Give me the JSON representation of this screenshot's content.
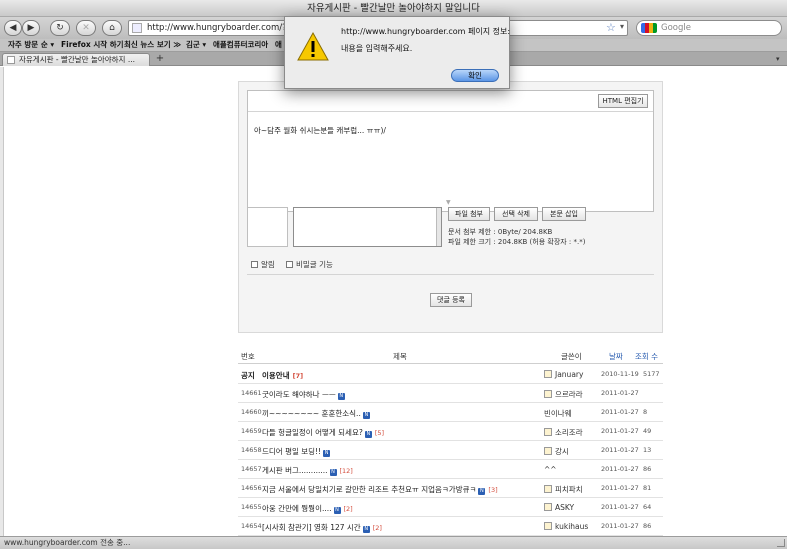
{
  "window": {
    "title": "자유게시판 - 빨간날만 놀아야하지 말입니다"
  },
  "toolbar": {
    "back_label": "◀",
    "forward_label": "▶",
    "reload_label": "↻",
    "stop_label": "✕",
    "home_label": "⌂",
    "url": "http://www.hungryboarder.com/?mid=",
    "search_placeholder": "Google"
  },
  "bookmarks": [
    "자주 방문 순 ▾",
    "Firefox 시작 하기",
    "최신 뉴스 보기 ≫",
    "김군 ▾",
    "애플컴퓨터코리아",
    "애"
  ],
  "tab": {
    "label": "자유게시판 - 빨간날만 놀아야하지 ...",
    "new_tab_label": "+"
  },
  "dialog": {
    "title": "http://www.hungryboarder.com 페이지 정보:",
    "message": "내용을 입력해주세요.",
    "ok_label": "확인"
  },
  "editor": {
    "html_button": "HTML 편집기",
    "content": "아~담주 월화 쉬시는분들 캐부럽... ㅠㅠ)/"
  },
  "attachments": {
    "attach_button": "파일 첨부",
    "delete_button": "선택 삭제",
    "insert_button": "본문 삽입",
    "limit_text": "문서 첨부 제한 : 0Byte/ 204.8KB",
    "size_text": "파일 제한 크기 : 204.8KB (허용 확장자 : *.*)"
  },
  "options": {
    "notify_label": "알림",
    "secret_label": "비밀글 기능"
  },
  "submit_button": "댓글 등록",
  "list": {
    "headers": {
      "number": "번호",
      "title": "제목",
      "author": "글쓴이",
      "date": "날짜",
      "views": "조회 수"
    },
    "rows": [
      {
        "num": "공지",
        "title": "이용안내",
        "comments": "[7]",
        "new": false,
        "author": "January",
        "date": "2010-11-19",
        "views": "5177",
        "notice": true
      },
      {
        "num": "14661",
        "title": "굿이라도 해야하나 ㅡㅡ",
        "comments": "",
        "new": true,
        "author": "으르라라",
        "date": "2011-01-27",
        "views": "",
        "notice": false
      },
      {
        "num": "14660",
        "title": "끼~~~~~~~~ 훈훈한소식..",
        "comments": "",
        "new": true,
        "author": "빈이나웨",
        "date": "2011-01-27",
        "views": "8",
        "notice": false
      },
      {
        "num": "14659",
        "title": "다들 헝글일정이 어떻게 되세요?",
        "comments": "[5]",
        "new": true,
        "author": "소리조라",
        "date": "2011-01-27",
        "views": "49",
        "notice": false
      },
      {
        "num": "14658",
        "title": "드디어 평일 보딩!!",
        "comments": "",
        "new": true,
        "author": "강시",
        "date": "2011-01-27",
        "views": "13",
        "notice": false
      },
      {
        "num": "14657",
        "title": "게시판 버그............",
        "comments": "[12]",
        "new": true,
        "author": "^^",
        "date": "2011-01-27",
        "views": "86",
        "notice": false
      },
      {
        "num": "14656",
        "title": "지금 서울에서 당일치기로 갈만한 리조트 추천요ㅠ 지업음ㅋ가방큐ㅋ",
        "comments": "[3]",
        "new": true,
        "author": "피치파치",
        "date": "2011-01-27",
        "views": "81",
        "notice": false
      },
      {
        "num": "14655",
        "title": "아웅 간만에 뭥뭥이....",
        "comments": "[2]",
        "new": true,
        "author": "ASKY",
        "date": "2011-01-27",
        "views": "64",
        "notice": false
      },
      {
        "num": "14654",
        "title": "[시사회 참관기] 영화 127 시간",
        "comments": "[2]",
        "new": true,
        "author": "kukihaus",
        "date": "2011-01-27",
        "views": "86",
        "notice": false
      }
    ]
  },
  "status": {
    "text": "www.hungryboarder.com 전송 중..."
  }
}
